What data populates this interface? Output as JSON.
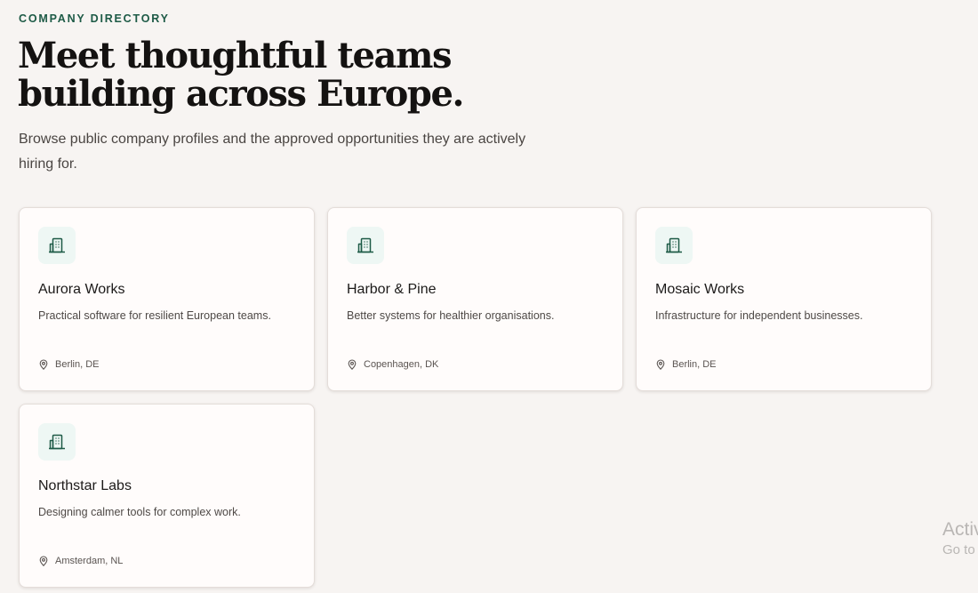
{
  "header": {
    "eyebrow": "COMPANY DIRECTORY",
    "title": "Meet thoughtful teams building across Europe.",
    "subtitle": "Browse public company profiles and the approved opportunities they are actively hiring for."
  },
  "companies": [
    {
      "name": "Aurora Works",
      "description": "Practical software for resilient European teams.",
      "location": "Berlin, DE",
      "icon": "building-icon"
    },
    {
      "name": "Harbor & Pine",
      "description": "Better systems for healthier organisations.",
      "location": "Copenhagen, DK",
      "icon": "building-icon"
    },
    {
      "name": "Mosaic Works",
      "description": "Infrastructure for independent businesses.",
      "location": "Berlin, DE",
      "icon": "building-icon"
    },
    {
      "name": "Northstar Labs",
      "description": "Designing calmer tools for complex work.",
      "location": "Amsterdam, NL",
      "icon": "building-icon"
    }
  ],
  "watermark": {
    "line1": "Activ",
    "line2": "Go to"
  },
  "colors": {
    "background": "#f7f4f2",
    "accent": "#1d5a46",
    "icon_bg": "#eef7f4",
    "card_bg": "#fffcfb"
  }
}
